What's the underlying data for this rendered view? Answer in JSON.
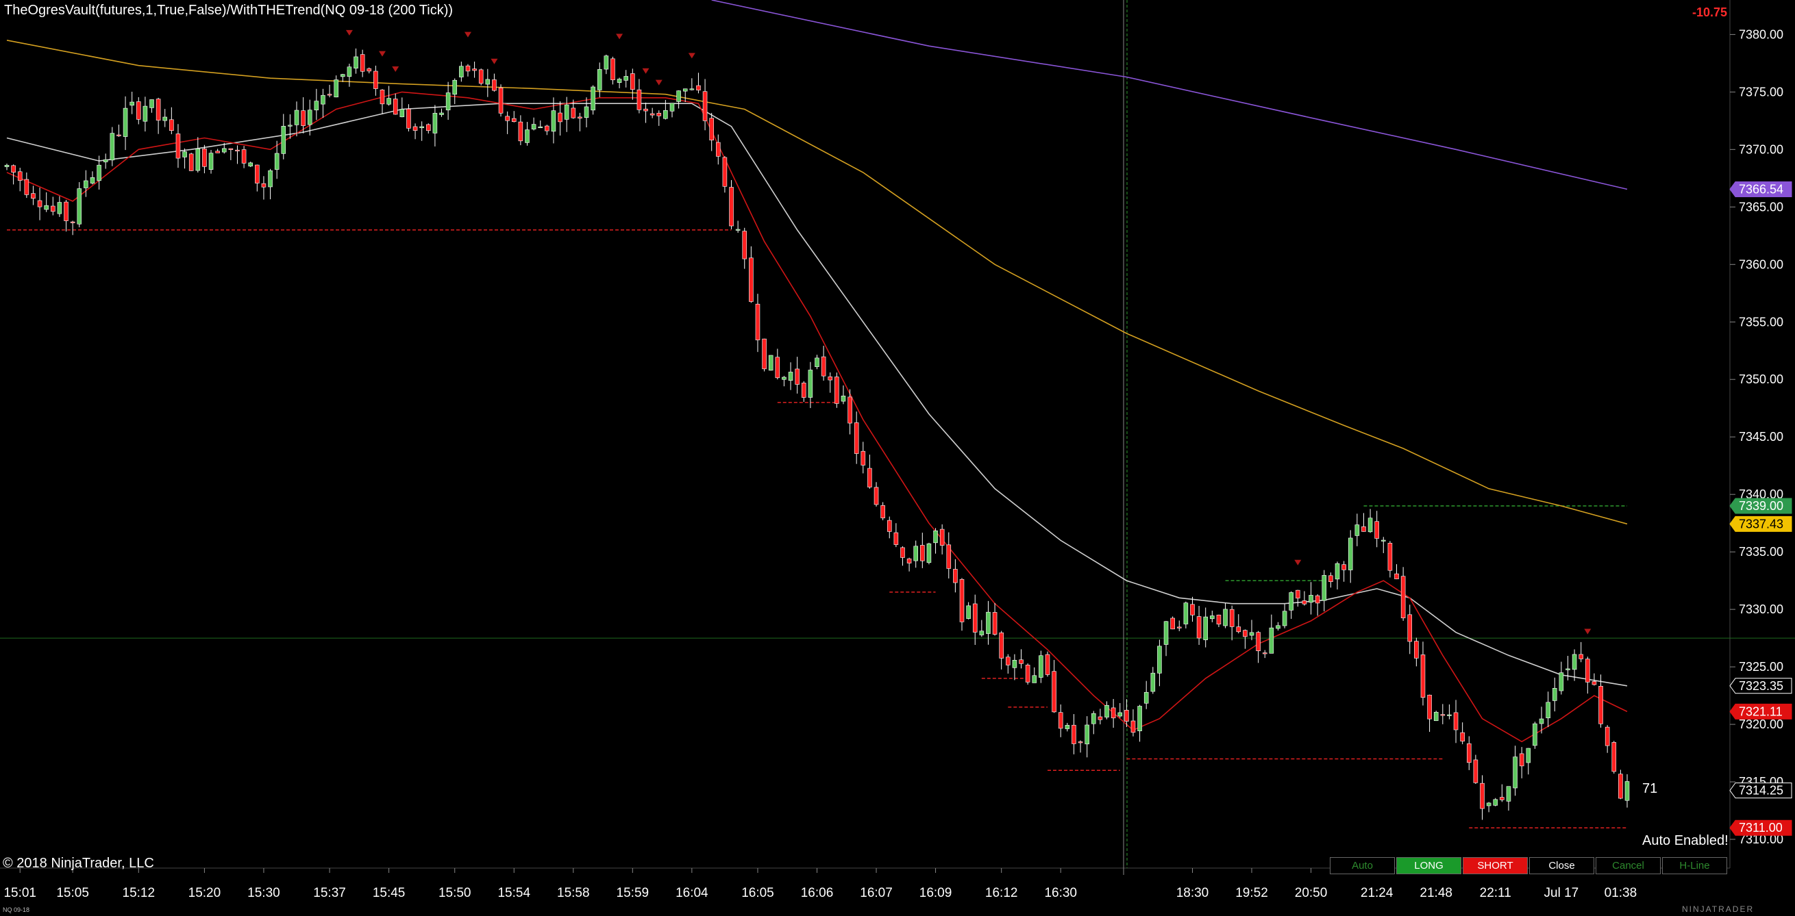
{
  "header": {
    "title": "TheOgresVault(futures,1,True,False)/WithTHETrend(NQ 09-18 (200 Tick))",
    "pnl": "-10.75"
  },
  "footer": {
    "copyright": "© 2018 NinjaTrader, LLC",
    "instrument_code": "NQ 09-18",
    "logo": "NINJATRADER"
  },
  "overlay": {
    "bar_counter": "71",
    "auto_status": "Auto Enabled!"
  },
  "buttons": [
    {
      "label": "Auto",
      "key": "auto"
    },
    {
      "label": "LONG",
      "key": "long"
    },
    {
      "label": "SHORT",
      "key": "short"
    },
    {
      "label": "Close",
      "key": "close"
    },
    {
      "label": "Cancel",
      "key": "cancel"
    },
    {
      "label": "H-Line",
      "key": "hline"
    }
  ],
  "colors": {
    "background": "#000000",
    "up_candle": "#5ec85e",
    "down_candle": "#ff2020",
    "ema_red": "#d01515",
    "sma_white": "#d0d0d0",
    "sma_gold": "#d4a020",
    "sma_purple": "#8a55d8",
    "support_line": "#e02020",
    "resistance_line": "#2e9a2e",
    "accent_long": "#1a9a2a",
    "accent_short": "#e01010"
  },
  "chart_data": {
    "type": "candlestick",
    "ylim": [
      7307.5,
      7383
    ],
    "y_ticks": [
      "7380.00",
      "7375.00",
      "7370.00",
      "7365.00",
      "7360.00",
      "7355.00",
      "7350.00",
      "7345.00",
      "7340.00",
      "7335.00",
      "7330.00",
      "7325.00",
      "7320.00",
      "7315.00",
      "7310.00"
    ],
    "x_ticks": [
      {
        "label": "15:01",
        "bar": 2
      },
      {
        "label": "15:05",
        "bar": 10
      },
      {
        "label": "15:12",
        "bar": 20
      },
      {
        "label": "15:20",
        "bar": 30
      },
      {
        "label": "15:30",
        "bar": 39
      },
      {
        "label": "15:37",
        "bar": 49
      },
      {
        "label": "15:45",
        "bar": 58
      },
      {
        "label": "15:50",
        "bar": 68
      },
      {
        "label": "15:54",
        "bar": 77
      },
      {
        "label": "15:58",
        "bar": 86
      },
      {
        "label": "15:59",
        "bar": 95
      },
      {
        "label": "16:04",
        "bar": 104
      },
      {
        "label": "16:05",
        "bar": 114
      },
      {
        "label": "16:06",
        "bar": 123
      },
      {
        "label": "16:07",
        "bar": 132
      },
      {
        "label": "16:09",
        "bar": 141
      },
      {
        "label": "16:12",
        "bar": 151
      },
      {
        "label": "16:30",
        "bar": 160
      },
      {
        "label": "18:30",
        "bar": 180
      },
      {
        "label": "19:52",
        "bar": 189
      },
      {
        "label": "20:50",
        "bar": 198
      },
      {
        "label": "21:24",
        "bar": 208
      },
      {
        "label": "21:48",
        "bar": 217
      },
      {
        "label": "22:11",
        "bar": 226
      },
      {
        "label": "Jul 17",
        "bar": 236
      },
      {
        "label": "01:38",
        "bar": 245
      }
    ],
    "price_tags": [
      {
        "price": 7366.54,
        "label": "7366.54",
        "color": "#8a55d8",
        "text": "#ffffff"
      },
      {
        "price": 7339.0,
        "label": "7339.00",
        "color": "#2e9a4e",
        "text": "#ffffff"
      },
      {
        "price": 7337.43,
        "label": "7337.43",
        "color": "#f2c200",
        "text": "#000000"
      },
      {
        "price": 7323.35,
        "label": "7323.35",
        "color": "#000000",
        "text": "#ffffff"
      },
      {
        "price": 7321.11,
        "label": "7321.11",
        "color": "#e01010",
        "text": "#ffffff"
      },
      {
        "price": 7314.25,
        "label": "7314.25",
        "color": "#000000",
        "text": "#ffffff"
      },
      {
        "price": 7311.0,
        "label": "7311.00",
        "color": "#e01010",
        "text": "#ffffff"
      }
    ],
    "levels": [
      {
        "price": 7363.0,
        "from_bar": 0,
        "to_bar": 110,
        "style": "support"
      },
      {
        "price": 7348.0,
        "from_bar": 117,
        "to_bar": 126,
        "style": "support"
      },
      {
        "price": 7331.5,
        "from_bar": 134,
        "to_bar": 141,
        "style": "support"
      },
      {
        "price": 7324.0,
        "from_bar": 148,
        "to_bar": 155,
        "style": "support"
      },
      {
        "price": 7321.5,
        "from_bar": 152,
        "to_bar": 158,
        "style": "support"
      },
      {
        "price": 7316.0,
        "from_bar": 158,
        "to_bar": 169,
        "style": "support"
      },
      {
        "price": 7317.0,
        "from_bar": 170,
        "to_bar": 218,
        "style": "support"
      },
      {
        "price": 7311.0,
        "from_bar": 222,
        "to_bar": 246,
        "style": "support"
      },
      {
        "price": 7339.0,
        "from_bar": 206,
        "to_bar": 246,
        "style": "resistance"
      },
      {
        "price": 7332.5,
        "from_bar": 185,
        "to_bar": 200,
        "style": "resistance"
      }
    ],
    "horizontal_line": 7327.5,
    "vertical_marker_bar": 169,
    "signal_arrows": [
      52,
      57,
      59,
      70,
      74,
      93,
      97,
      99,
      104,
      196,
      240
    ],
    "anchors": [
      [
        0,
        7368.5
      ],
      [
        2,
        7367.5
      ],
      [
        5,
        7366
      ],
      [
        7,
        7364.5
      ],
      [
        10,
        7364
      ],
      [
        12,
        7367.5
      ],
      [
        15,
        7369.5
      ],
      [
        18,
        7373
      ],
      [
        21,
        7374
      ],
      [
        24,
        7372
      ],
      [
        27,
        7369
      ],
      [
        30,
        7369.5
      ],
      [
        33,
        7371
      ],
      [
        36,
        7368.5
      ],
      [
        39,
        7367
      ],
      [
        42,
        7371
      ],
      [
        45,
        7373
      ],
      [
        48,
        7375
      ],
      [
        51,
        7376.5
      ],
      [
        54,
        7377.5
      ],
      [
        57,
        7375
      ],
      [
        60,
        7373
      ],
      [
        63,
        7371
      ],
      [
        66,
        7373.5
      ],
      [
        69,
        7377
      ],
      [
        72,
        7376
      ],
      [
        75,
        7373.5
      ],
      [
        78,
        7371.5
      ],
      [
        81,
        7372
      ],
      [
        84,
        7373.5
      ],
      [
        87,
        7373
      ],
      [
        90,
        7377.5
      ],
      [
        93,
        7376.5
      ],
      [
        96,
        7374
      ],
      [
        99,
        7372.5
      ],
      [
        102,
        7375.5
      ],
      [
        105,
        7374.5
      ],
      [
        107,
        7371
      ],
      [
        109,
        7366.5
      ],
      [
        111,
        7362
      ],
      [
        113,
        7357
      ],
      [
        115,
        7352
      ],
      [
        117,
        7350
      ],
      [
        119,
        7350.5
      ],
      [
        121,
        7349.5
      ],
      [
        123,
        7351
      ],
      [
        125,
        7350.5
      ],
      [
        127,
        7347.5
      ],
      [
        129,
        7344
      ],
      [
        131,
        7340
      ],
      [
        133,
        7338.5
      ],
      [
        135,
        7336.5
      ],
      [
        137,
        7334
      ],
      [
        139,
        7335
      ],
      [
        141,
        7336.5
      ],
      [
        143,
        7333
      ],
      [
        145,
        7330
      ],
      [
        147,
        7328.5
      ],
      [
        149,
        7329
      ],
      [
        151,
        7326.5
      ],
      [
        153,
        7326
      ],
      [
        155,
        7324.5
      ],
      [
        157,
        7325
      ],
      [
        159,
        7322
      ],
      [
        161,
        7319
      ],
      [
        163,
        7318
      ],
      [
        165,
        7320
      ],
      [
        167,
        7321.5
      ],
      [
        169,
        7320.5
      ],
      [
        171,
        7320
      ],
      [
        173,
        7323
      ],
      [
        175,
        7327
      ],
      [
        177,
        7329
      ],
      [
        179,
        7330
      ],
      [
        181,
        7328.5
      ],
      [
        183,
        7330
      ],
      [
        185,
        7329
      ],
      [
        187,
        7327
      ],
      [
        189,
        7327.5
      ],
      [
        191,
        7326.5
      ],
      [
        193,
        7328.5
      ],
      [
        195,
        7330.5
      ],
      [
        197,
        7331
      ],
      [
        199,
        7331.5
      ],
      [
        201,
        7333
      ],
      [
        203,
        7334.5
      ],
      [
        205,
        7336.5
      ],
      [
        207,
        7337
      ],
      [
        209,
        7335
      ],
      [
        211,
        7333
      ],
      [
        213,
        7327.5
      ],
      [
        215,
        7322.5
      ],
      [
        217,
        7320.5
      ],
      [
        219,
        7320
      ],
      [
        221,
        7318
      ],
      [
        223,
        7315
      ],
      [
        225,
        7312.5
      ],
      [
        227,
        7314
      ],
      [
        229,
        7316.5
      ],
      [
        231,
        7318
      ],
      [
        233,
        7321
      ],
      [
        235,
        7324
      ],
      [
        237,
        7325.5
      ],
      [
        239,
        7326.5
      ],
      [
        241,
        7323
      ],
      [
        243,
        7318.5
      ],
      [
        245,
        7314.25
      ]
    ],
    "sma_white": [
      [
        0,
        7371
      ],
      [
        14,
        7369
      ],
      [
        28,
        7370
      ],
      [
        45,
        7371.5
      ],
      [
        60,
        7373.5
      ],
      [
        75,
        7374
      ],
      [
        92,
        7374
      ],
      [
        104,
        7374
      ],
      [
        110,
        7372
      ],
      [
        120,
        7363
      ],
      [
        130,
        7355
      ],
      [
        140,
        7347
      ],
      [
        150,
        7340.5
      ],
      [
        160,
        7336
      ],
      [
        170,
        7332.5
      ],
      [
        178,
        7331
      ],
      [
        186,
        7330.5
      ],
      [
        194,
        7330.5
      ],
      [
        200,
        7330.8
      ],
      [
        208,
        7331.8
      ],
      [
        213,
        7331
      ],
      [
        220,
        7328
      ],
      [
        228,
        7326
      ],
      [
        236,
        7324.3
      ],
      [
        246,
        7323.35
      ]
    ],
    "ema_red": [
      [
        0,
        7368
      ],
      [
        10,
        7365.5
      ],
      [
        20,
        7370
      ],
      [
        30,
        7371
      ],
      [
        40,
        7370
      ],
      [
        50,
        7373.5
      ],
      [
        60,
        7375
      ],
      [
        70,
        7374.5
      ],
      [
        80,
        7373.5
      ],
      [
        90,
        7374.5
      ],
      [
        100,
        7374.5
      ],
      [
        105,
        7374
      ],
      [
        110,
        7368
      ],
      [
        115,
        7362
      ],
      [
        122,
        7355.5
      ],
      [
        130,
        7346.5
      ],
      [
        140,
        7337.5
      ],
      [
        150,
        7330.5
      ],
      [
        158,
        7326.5
      ],
      [
        165,
        7322.5
      ],
      [
        171,
        7319.5
      ],
      [
        175,
        7320.5
      ],
      [
        182,
        7324
      ],
      [
        190,
        7327
      ],
      [
        198,
        7329
      ],
      [
        205,
        7331.5
      ],
      [
        209,
        7332.5
      ],
      [
        213,
        7331
      ],
      [
        218,
        7326
      ],
      [
        224,
        7320.5
      ],
      [
        230,
        7318.5
      ],
      [
        236,
        7320.5
      ],
      [
        241,
        7322.5
      ],
      [
        246,
        7321.11
      ]
    ],
    "sma_gold": [
      [
        0,
        7379.5
      ],
      [
        20,
        7377.3
      ],
      [
        40,
        7376.2
      ],
      [
        60,
        7375.7
      ],
      [
        80,
        7375.3
      ],
      [
        100,
        7374.8
      ],
      [
        112,
        7373.5
      ],
      [
        130,
        7368
      ],
      [
        150,
        7360
      ],
      [
        170,
        7354
      ],
      [
        190,
        7349
      ],
      [
        203,
        7346
      ],
      [
        212,
        7344
      ],
      [
        225,
        7340.5
      ],
      [
        236,
        7339
      ],
      [
        246,
        7337.43
      ]
    ],
    "sma_purple": [
      [
        107,
        7383
      ],
      [
        140,
        7379
      ],
      [
        170,
        7376.3
      ],
      [
        200,
        7372.5
      ],
      [
        220,
        7370
      ],
      [
        246,
        7366.54
      ]
    ]
  }
}
